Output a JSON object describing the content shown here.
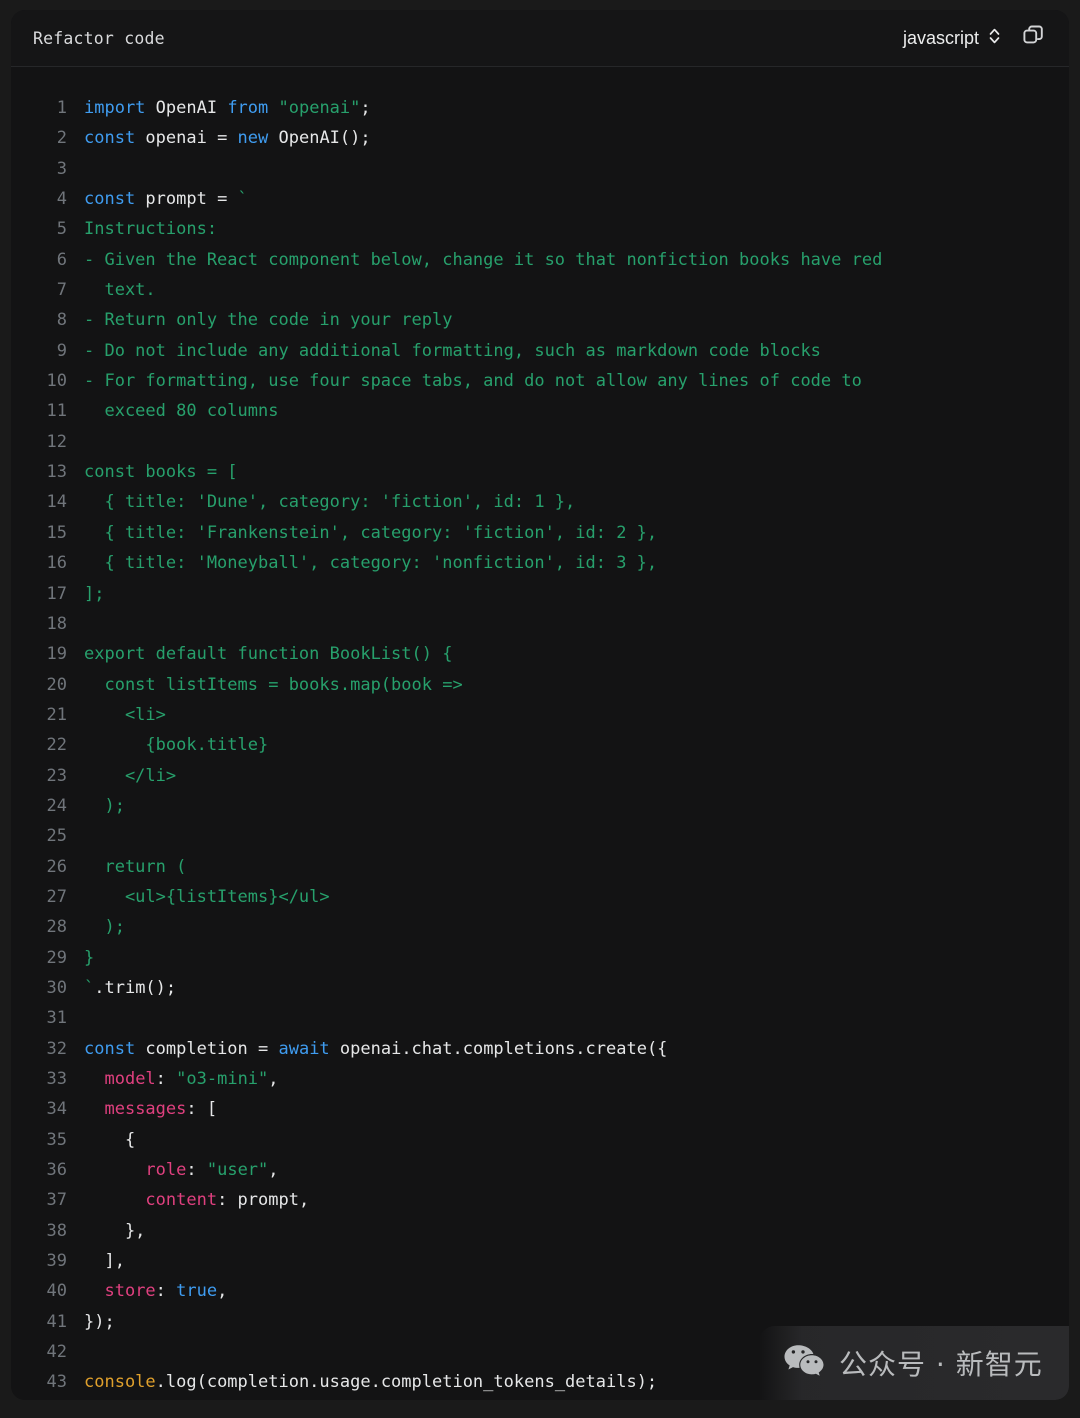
{
  "header": {
    "title": "Refactor code",
    "language_label": "javascript",
    "language_icon": "chevron-updown-icon",
    "copy_icon": "copy-icon"
  },
  "editor": {
    "language": "javascript",
    "total_lines": 43,
    "lines": [
      {
        "n": "1",
        "tokens": [
          {
            "t": "import ",
            "c": "kw"
          },
          {
            "t": "OpenAI ",
            "c": "pln"
          },
          {
            "t": "from ",
            "c": "kw"
          },
          {
            "t": "\"openai\"",
            "c": "str"
          },
          {
            "t": ";",
            "c": "pln"
          }
        ]
      },
      {
        "n": "2",
        "tokens": [
          {
            "t": "const ",
            "c": "kw"
          },
          {
            "t": "openai = ",
            "c": "pln"
          },
          {
            "t": "new ",
            "c": "kw"
          },
          {
            "t": "OpenAI();",
            "c": "pln"
          }
        ]
      },
      {
        "n": "3",
        "tokens": []
      },
      {
        "n": "4",
        "tokens": [
          {
            "t": "const ",
            "c": "kw"
          },
          {
            "t": "prompt = ",
            "c": "pln"
          },
          {
            "t": "`",
            "c": "str"
          }
        ]
      },
      {
        "n": "5",
        "tokens": [
          {
            "t": "Instructions:",
            "c": "str"
          }
        ]
      },
      {
        "n": "6",
        "tokens": [
          {
            "t": "- Given the React component below, change it so that nonfiction books have red",
            "c": "str"
          }
        ]
      },
      {
        "n": "7",
        "tokens": [
          {
            "t": "  text.",
            "c": "str"
          }
        ]
      },
      {
        "n": "8",
        "tokens": [
          {
            "t": "- Return only the code in your reply",
            "c": "str"
          }
        ]
      },
      {
        "n": "9",
        "tokens": [
          {
            "t": "- Do not include any additional formatting, such as markdown code blocks",
            "c": "str"
          }
        ]
      },
      {
        "n": "10",
        "tokens": [
          {
            "t": "- For formatting, use four space tabs, and do not allow any lines of code to",
            "c": "str"
          }
        ]
      },
      {
        "n": "11",
        "tokens": [
          {
            "t": "  exceed 80 columns",
            "c": "str"
          }
        ]
      },
      {
        "n": "12",
        "tokens": []
      },
      {
        "n": "13",
        "tokens": [
          {
            "t": "const books = [",
            "c": "str"
          }
        ]
      },
      {
        "n": "14",
        "tokens": [
          {
            "t": "  { title: 'Dune', category: 'fiction', id: 1 },",
            "c": "str"
          }
        ]
      },
      {
        "n": "15",
        "tokens": [
          {
            "t": "  { title: 'Frankenstein', category: 'fiction', id: 2 },",
            "c": "str"
          }
        ]
      },
      {
        "n": "16",
        "tokens": [
          {
            "t": "  { title: 'Moneyball', category: 'nonfiction', id: 3 },",
            "c": "str"
          }
        ]
      },
      {
        "n": "17",
        "tokens": [
          {
            "t": "];",
            "c": "str"
          }
        ]
      },
      {
        "n": "18",
        "tokens": []
      },
      {
        "n": "19",
        "tokens": [
          {
            "t": "export default function BookList() {",
            "c": "str"
          }
        ]
      },
      {
        "n": "20",
        "tokens": [
          {
            "t": "  const listItems = books.map(book =>",
            "c": "str"
          }
        ]
      },
      {
        "n": "21",
        "tokens": [
          {
            "t": "    <li>",
            "c": "str"
          }
        ]
      },
      {
        "n": "22",
        "tokens": [
          {
            "t": "      {book.title}",
            "c": "str"
          }
        ]
      },
      {
        "n": "23",
        "tokens": [
          {
            "t": "    </li>",
            "c": "str"
          }
        ]
      },
      {
        "n": "24",
        "tokens": [
          {
            "t": "  );",
            "c": "str"
          }
        ]
      },
      {
        "n": "25",
        "tokens": []
      },
      {
        "n": "26",
        "tokens": [
          {
            "t": "  return (",
            "c": "str"
          }
        ]
      },
      {
        "n": "27",
        "tokens": [
          {
            "t": "    <ul>{listItems}</ul>",
            "c": "str"
          }
        ]
      },
      {
        "n": "28",
        "tokens": [
          {
            "t": "  );",
            "c": "str"
          }
        ]
      },
      {
        "n": "29",
        "tokens": [
          {
            "t": "}",
            "c": "str"
          }
        ]
      },
      {
        "n": "30",
        "tokens": [
          {
            "t": "`",
            "c": "str"
          },
          {
            "t": ".trim();",
            "c": "pln"
          }
        ]
      },
      {
        "n": "31",
        "tokens": []
      },
      {
        "n": "32",
        "tokens": [
          {
            "t": "const ",
            "c": "kw"
          },
          {
            "t": "completion = ",
            "c": "pln"
          },
          {
            "t": "await ",
            "c": "kw"
          },
          {
            "t": "openai.chat.completions.create({",
            "c": "pln"
          }
        ]
      },
      {
        "n": "33",
        "tokens": [
          {
            "t": "  ",
            "c": "pln"
          },
          {
            "t": "model",
            "c": "prop"
          },
          {
            "t": ": ",
            "c": "pln"
          },
          {
            "t": "\"o3-mini\"",
            "c": "str"
          },
          {
            "t": ",",
            "c": "pln"
          }
        ]
      },
      {
        "n": "34",
        "tokens": [
          {
            "t": "  ",
            "c": "pln"
          },
          {
            "t": "messages",
            "c": "prop"
          },
          {
            "t": ": [",
            "c": "pln"
          }
        ]
      },
      {
        "n": "35",
        "tokens": [
          {
            "t": "    {",
            "c": "pln"
          }
        ]
      },
      {
        "n": "36",
        "tokens": [
          {
            "t": "      ",
            "c": "pln"
          },
          {
            "t": "role",
            "c": "prop"
          },
          {
            "t": ": ",
            "c": "pln"
          },
          {
            "t": "\"user\"",
            "c": "str"
          },
          {
            "t": ",",
            "c": "pln"
          }
        ]
      },
      {
        "n": "37",
        "tokens": [
          {
            "t": "      ",
            "c": "pln"
          },
          {
            "t": "content",
            "c": "prop"
          },
          {
            "t": ": prompt,",
            "c": "pln"
          }
        ]
      },
      {
        "n": "38",
        "tokens": [
          {
            "t": "    },",
            "c": "pln"
          }
        ]
      },
      {
        "n": "39",
        "tokens": [
          {
            "t": "  ],",
            "c": "pln"
          }
        ]
      },
      {
        "n": "40",
        "tokens": [
          {
            "t": "  ",
            "c": "pln"
          },
          {
            "t": "store",
            "c": "prop"
          },
          {
            "t": ": ",
            "c": "pln"
          },
          {
            "t": "true",
            "c": "kw"
          },
          {
            "t": ",",
            "c": "pln"
          }
        ]
      },
      {
        "n": "41",
        "tokens": [
          {
            "t": "});",
            "c": "pln"
          }
        ]
      },
      {
        "n": "42",
        "tokens": []
      },
      {
        "n": "43",
        "tokens": [
          {
            "t": "console",
            "c": "fn"
          },
          {
            "t": ".log(completion.usage.completion_tokens_details);",
            "c": "pln"
          }
        ]
      }
    ]
  },
  "watermark": {
    "icon": "wechat-icon",
    "text": "公众号 · 新智元"
  },
  "colors": {
    "page_background": "#1a1a1a",
    "panel_background": "#131314",
    "header_background": "#151516",
    "divider": "#262729",
    "keyword": "#3f9cf0",
    "string": "#27a06c",
    "property": "#e0407f",
    "function": "#e0a02c",
    "plain_text": "#e6e7e8",
    "line_number": "#70757b"
  }
}
